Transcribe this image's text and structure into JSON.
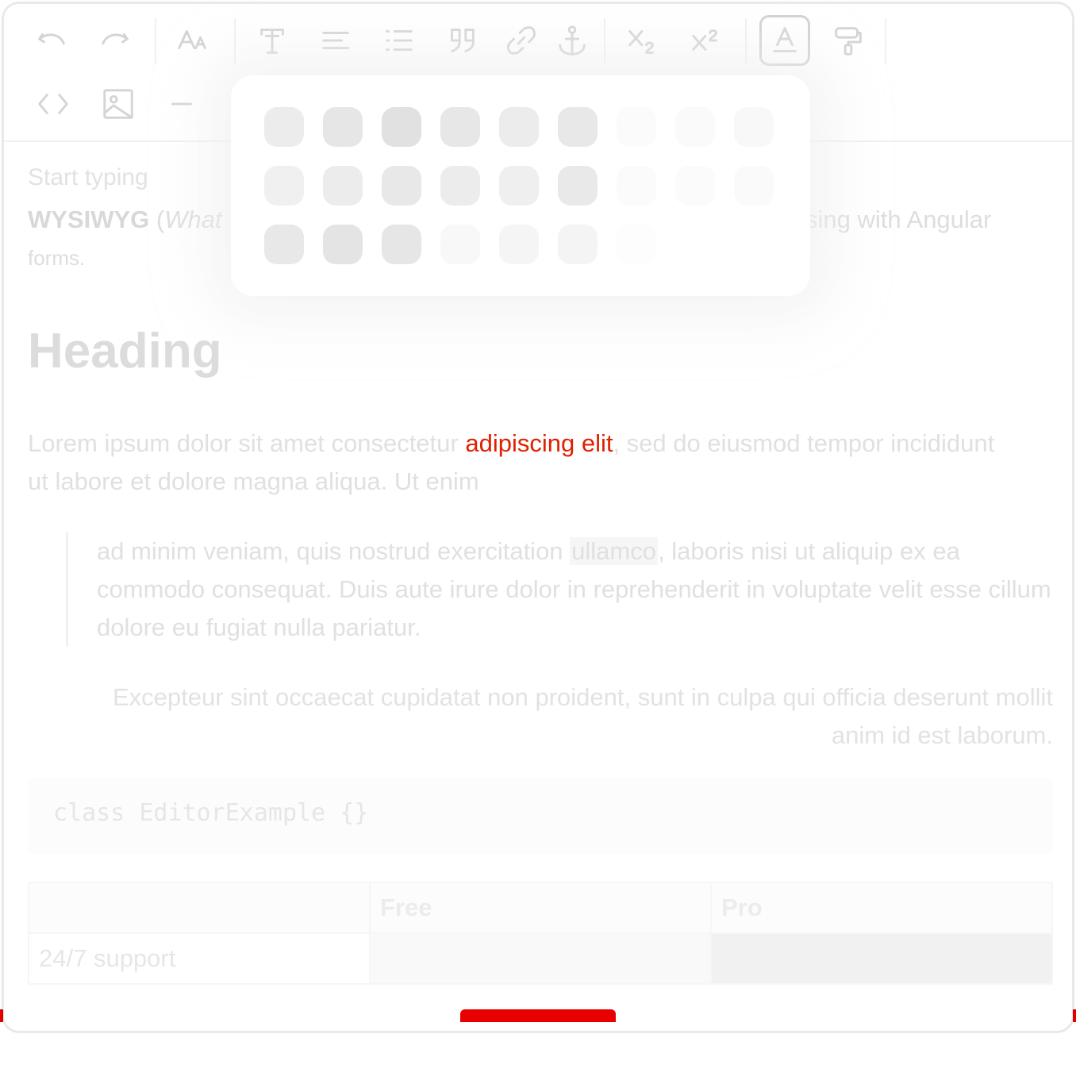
{
  "toolbar": {
    "tools": [
      "undo-icon",
      "redo-icon",
      "font-size-icon",
      "text-style-icon",
      "align-icon",
      "list-icon",
      "quote-icon",
      "link-icon",
      "anchor-icon",
      "subscript-icon",
      "superscript-icon",
      "text-color-icon",
      "format-painter-icon",
      "code-icon",
      "image-icon",
      "horizontal-rule-icon"
    ]
  },
  "content": {
    "placeholder": "Start typing",
    "intro_bold": "WYSIWYG",
    "intro_open": " (",
    "intro_italic": "What",
    "intro_tail": "sing with Angular",
    "intro_forms": "forms.",
    "heading": "Heading",
    "para_start": "Lorem ipsum dolor sit amet consectetur ",
    "para_highlight": "adipiscing elit",
    "para_end": ", sed do eiusmod tempor incididunt ut labore et dolore magna aliqua. Ut enim",
    "quote_start": "ad minim veniam, quis nostrud exercitation ",
    "quote_code": "ullamco",
    "quote_end": ", laboris nisi ut aliquip ex ea commodo consequat. Duis aute irure dolor in reprehenderit in voluptate velit esse cillum dolore eu fugiat nulla pariatur.",
    "right_para": "Excepteur sint occaecat cupidatat non proident, sunt in culpa qui officia deserunt mollit anim id est laborum.",
    "code": "class EditorExample {}",
    "table": {
      "headers": [
        "",
        "Free",
        "Pro"
      ],
      "rows": [
        [
          "24/7 support",
          "",
          ""
        ]
      ]
    }
  },
  "colors": {
    "highlight": "#e02000",
    "status_bar": "#e80000",
    "swatches": [
      [
        "#ececec",
        "#e6e6e6",
        "#e1e1e1",
        "#e7e7e7",
        "#ececec",
        "#e8e8e8",
        "#fbfbfb",
        "#fafafa",
        "#f8f8f8"
      ],
      [
        "#f0f0f0",
        "#ececec",
        "#e8e8e8",
        "#ececec",
        "#efefef",
        "#e9e9e9",
        "#fbfbfb",
        "#fbfbfb",
        "#fafafa"
      ],
      [
        "#e8e8e8",
        "#e4e4e4",
        "#e6e6e6",
        "#f8f8f8",
        "#f5f5f5",
        "#f4f4f4",
        "#fdfdfd"
      ]
    ]
  }
}
